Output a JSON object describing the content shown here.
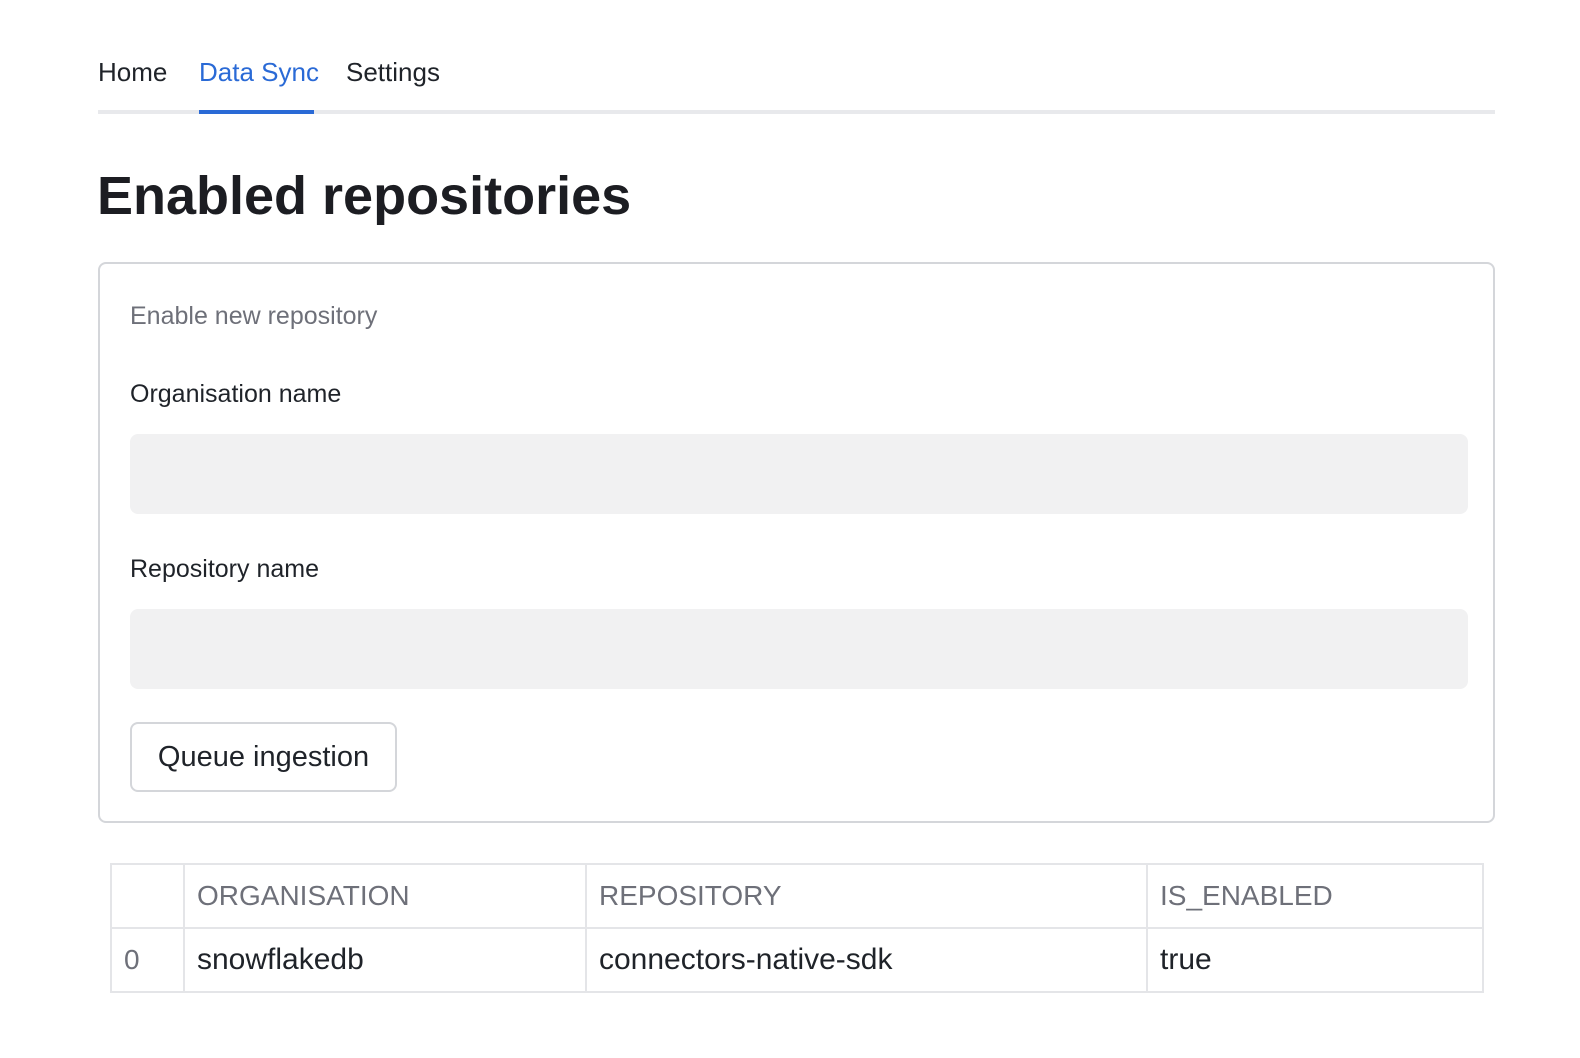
{
  "tabs": [
    {
      "label": "Home",
      "active": false
    },
    {
      "label": "Data Sync",
      "active": true
    },
    {
      "label": "Settings",
      "active": false
    }
  ],
  "page_title": "Enabled repositories",
  "form": {
    "title": "Enable new repository",
    "organisation_label": "Organisation name",
    "organisation_value": "",
    "repository_label": "Repository name",
    "repository_value": "",
    "submit_label": "Queue ingestion"
  },
  "table": {
    "columns": [
      "",
      "ORGANISATION",
      "REPOSITORY",
      "IS_ENABLED"
    ],
    "rows": [
      {
        "index": "0",
        "organisation": "snowflakedb",
        "repository": "connectors-native-sdk",
        "is_enabled": "true"
      }
    ]
  },
  "colors": {
    "accent": "#2a6ad6",
    "text": "#1f2329",
    "muted": "#6e7079",
    "border": "#d4d6da",
    "input_bg": "#f1f1f2"
  }
}
